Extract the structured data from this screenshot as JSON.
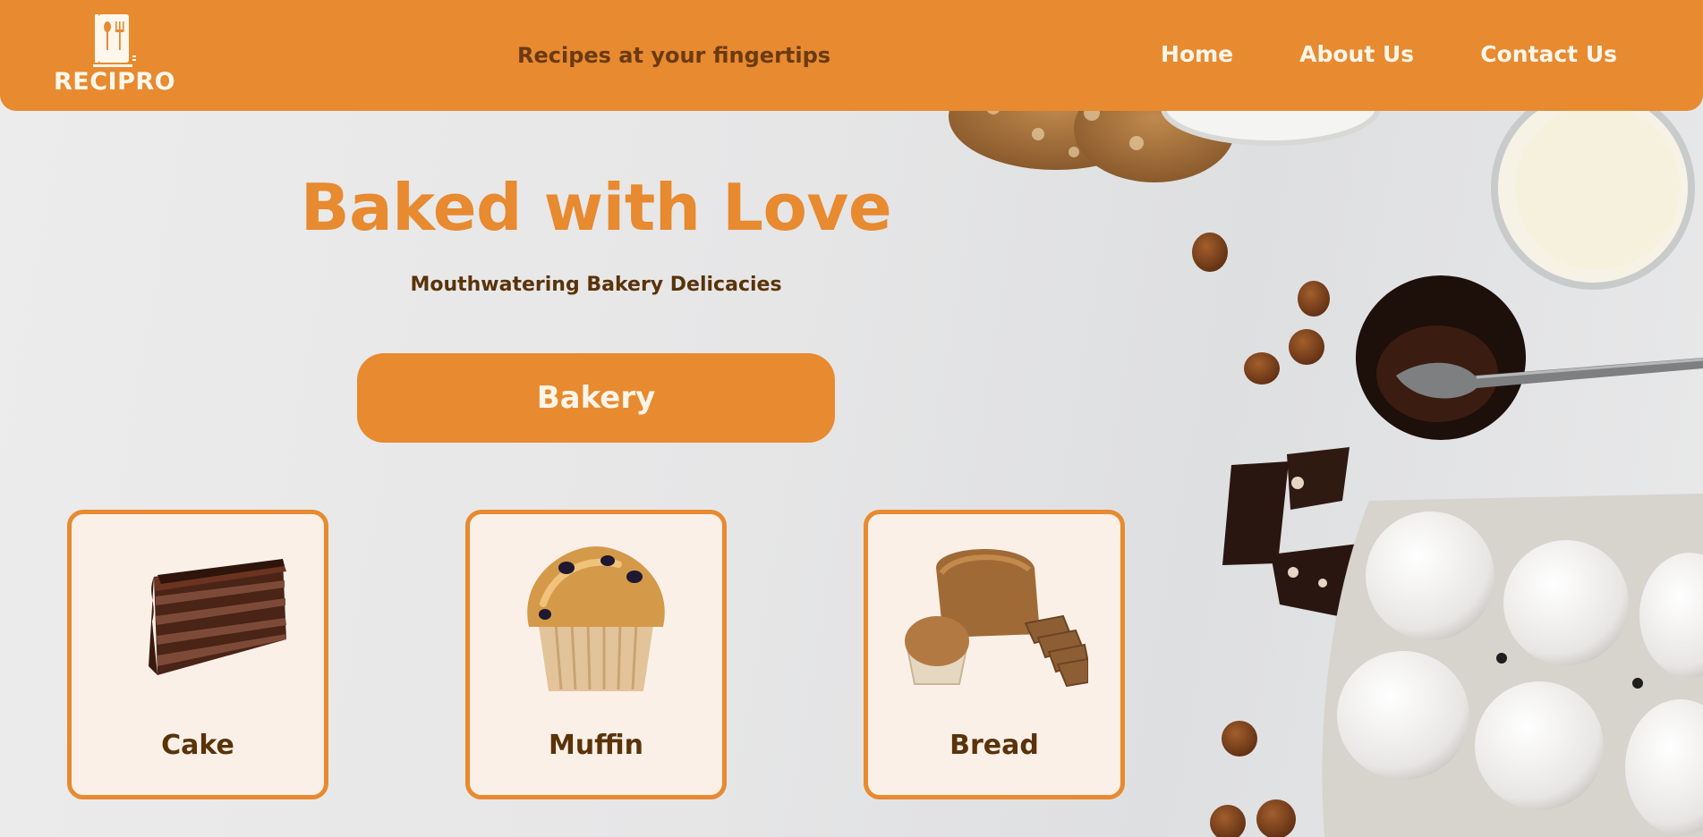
{
  "brand": {
    "name": "RECIPRO",
    "accent": "#e78a30",
    "dark_text": "#5a3309"
  },
  "header": {
    "tagline": "Recipes at your fingertips",
    "nav": [
      "Home",
      "About Us",
      "Contact Us"
    ]
  },
  "hero": {
    "title": "Baked with Love",
    "subtitle": "Mouthwatering Bakery Delicacies",
    "button_label": "Bakery"
  },
  "categories": [
    {
      "label": "Cake",
      "icon": "cake-slice-icon"
    },
    {
      "label": "Muffin",
      "icon": "muffin-icon"
    },
    {
      "label": "Bread",
      "icon": "bread-icon"
    }
  ]
}
